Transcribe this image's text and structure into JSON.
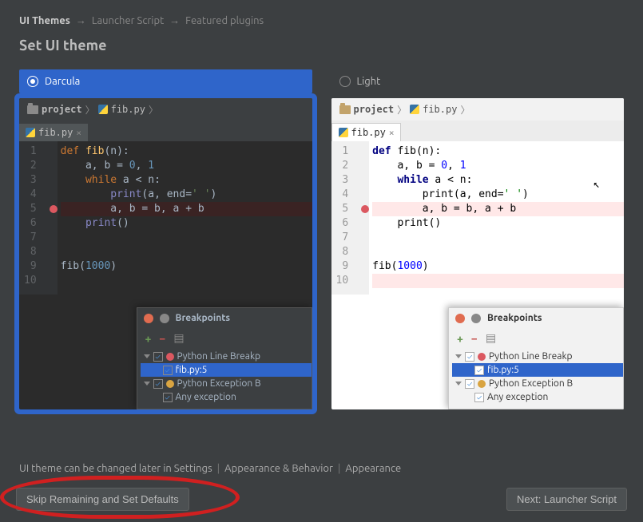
{
  "breadcrumb": {
    "step1": "UI Themes",
    "step2": "Launcher Script",
    "step3": "Featured plugins",
    "sep": "→"
  },
  "title": "Set UI theme",
  "themes": {
    "darcula": "Darcula",
    "light": "Light"
  },
  "pathbar": {
    "project": "project",
    "file": "fib.py"
  },
  "tab": {
    "name": "fib.py"
  },
  "code": {
    "l1": {
      "def": "def",
      "fn": "fib",
      "rest": "(n):"
    },
    "l2": {
      "pre": "    a, b = ",
      "n0": "0",
      "c": ", ",
      "n1": "1"
    },
    "l3": {
      "pre": "    ",
      "kw": "while",
      "rest": " a < n:"
    },
    "l4": {
      "pre": "        ",
      "bi": "print",
      "open": "(a, ",
      "arg": "end",
      "eq": "=",
      "str": "' '",
      "close": ")"
    },
    "l5": {
      "txt": "        a, b = b, a + b"
    },
    "l6": {
      "pre": "    ",
      "bi": "print",
      "rest": "()"
    },
    "l9": {
      "fn": "fib",
      "open": "(",
      "num": "1000",
      "close": ")"
    }
  },
  "linenums": [
    "1",
    "2",
    "3",
    "4",
    "5",
    "6",
    "7",
    "8",
    "9",
    "10"
  ],
  "bp": {
    "title": "Breakpoints",
    "root1": "Python Line Breakp",
    "leaf1": "fib.py:5",
    "root2": "Python Exception B",
    "leaf2": "Any exception"
  },
  "hint": {
    "t1": "UI theme can be changed later in Settings",
    "t2": "Appearance & Behavior",
    "t3": "Appearance"
  },
  "buttons": {
    "skip": "Skip Remaining and Set Defaults",
    "next": "Next: Launcher Script"
  }
}
